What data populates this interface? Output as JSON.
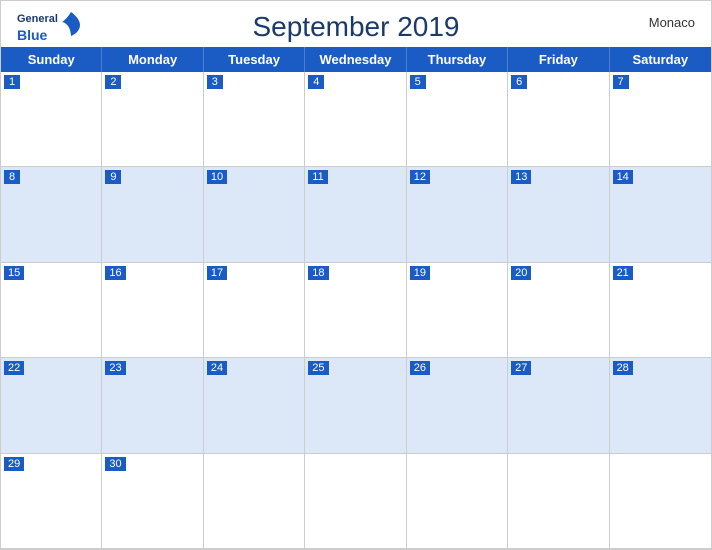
{
  "header": {
    "title": "September 2019",
    "country": "Monaco",
    "logo_general": "General",
    "logo_blue": "Blue"
  },
  "days_of_week": [
    "Sunday",
    "Monday",
    "Tuesday",
    "Wednesday",
    "Thursday",
    "Friday",
    "Saturday"
  ],
  "weeks": [
    [
      {
        "num": "1",
        "empty": false
      },
      {
        "num": "2",
        "empty": false
      },
      {
        "num": "3",
        "empty": false
      },
      {
        "num": "4",
        "empty": false
      },
      {
        "num": "5",
        "empty": false
      },
      {
        "num": "6",
        "empty": false
      },
      {
        "num": "7",
        "empty": false
      }
    ],
    [
      {
        "num": "8",
        "empty": false
      },
      {
        "num": "9",
        "empty": false
      },
      {
        "num": "10",
        "empty": false
      },
      {
        "num": "11",
        "empty": false
      },
      {
        "num": "12",
        "empty": false
      },
      {
        "num": "13",
        "empty": false
      },
      {
        "num": "14",
        "empty": false
      }
    ],
    [
      {
        "num": "15",
        "empty": false
      },
      {
        "num": "16",
        "empty": false
      },
      {
        "num": "17",
        "empty": false
      },
      {
        "num": "18",
        "empty": false
      },
      {
        "num": "19",
        "empty": false
      },
      {
        "num": "20",
        "empty": false
      },
      {
        "num": "21",
        "empty": false
      }
    ],
    [
      {
        "num": "22",
        "empty": false
      },
      {
        "num": "23",
        "empty": false
      },
      {
        "num": "24",
        "empty": false
      },
      {
        "num": "25",
        "empty": false
      },
      {
        "num": "26",
        "empty": false
      },
      {
        "num": "27",
        "empty": false
      },
      {
        "num": "28",
        "empty": false
      }
    ],
    [
      {
        "num": "29",
        "empty": false
      },
      {
        "num": "30",
        "empty": false
      },
      {
        "num": "",
        "empty": true
      },
      {
        "num": "",
        "empty": true
      },
      {
        "num": "",
        "empty": true
      },
      {
        "num": "",
        "empty": true
      },
      {
        "num": "",
        "empty": true
      }
    ]
  ],
  "colors": {
    "header_blue": "#1a5bc4",
    "dark_blue": "#1a3a6e",
    "row_even_bg": "#dce8f8"
  }
}
